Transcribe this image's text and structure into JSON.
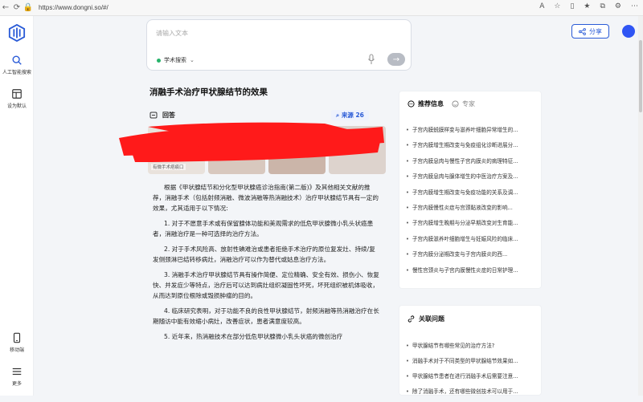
{
  "browser": {
    "url": "https://www.dongni.so/#/"
  },
  "sidebar": {
    "items": [
      {
        "label": "人工智能搜索",
        "icon": "search-icon"
      },
      {
        "label": "设为默认",
        "icon": "layout-icon"
      },
      {
        "label": "移动端",
        "icon": "mobile-icon"
      },
      {
        "label": "更多",
        "icon": "menu-icon"
      }
    ]
  },
  "header": {
    "share_label": "分享"
  },
  "search": {
    "placeholder": "请输入文本",
    "mode_label": "学术搜索"
  },
  "article": {
    "title": "消融手术治疗甲状腺结节的效果",
    "answer_label": "回答",
    "source_label": "来源 26",
    "image_caption": "有微手术疤痕口",
    "paragraphs": [
      "根据《甲状腺结节和分化型甲状腺癌诊治指南(第二版)》及其他相关文献的推荐，消融手术（包括射频消融、微波消融等热消融技术）治疗甲状腺结节具有一定的效果，尤其适用于以下情况:",
      "1. 对于不愿意手术或有保留腺体功能和美观需求的低危甲状腺微小乳头状癌患者，消融治疗是一种可选择的治疗方法。",
      "2. 对于手术风险高、放射性碘难治或患者拒绝手术治疗的原位复发灶、持续/复发侧颈淋巴结转移病灶，消融治疗可以作为替代或姑息治疗方法。",
      "3. 消融手术治疗甲状腺结节具有操作简便、定位精确、安全有效、损伤小、恢复快、并发症少等特点，治疗后可以达到病灶组织凝固性坏死，坏死组织被机体吸收，从而达到原位根除或毁损肿瘤的目的。",
      "4. 临床研究表明，对于功能不良的良性甲状腺结节，射频消融等热消融治疗在长期随访中能有效缩小病灶，改善症状，患者满意度较高。",
      "5. 近年来，热消融技术在部分低危甲状腺微小乳头状癌的微创治疗"
    ]
  },
  "recommend": {
    "tab_active": "推荐信息",
    "tab_inactive": "专家",
    "items": [
      "子宫内膜蜕膜样变与滋养叶细胞异常增生的...",
      "子宫内膜增生期改变与免疫组化诊断进展分...",
      "子宫内膜息肉与慢性子宫内膜炎的病理特征...",
      "子宫内膜息肉与腺体增生的中医治疗方案及...",
      "子宫内膜增生期改变与免疫功能的关系及调...",
      "子宫内膜慢性炎症与宫颈黏液改变的影响...",
      "子宫内膜增生晚期与分泌早期改变对生育能...",
      "子宫内膜滋养叶细胞增生与妊娠风险的临床...",
      "子宫内膜分泌期改变与子宫内膜炎的西...",
      "慢性宫颈炎与子宫内膜慢性炎症的日常护理..."
    ]
  },
  "related": {
    "title": "关联问题",
    "items": [
      "甲状腺结节有哪些常见的治疗方法?",
      "消融手术对于不同类型的甲状腺结节效果如...",
      "甲状腺结节患者在进行消融手术后需要注意...",
      "除了消融手术，还有哪些微创技术可以用于..."
    ]
  },
  "colors": {
    "accent": "#2a5bd7",
    "avatar": "#2f55f4",
    "redaction": "#ff1a1a"
  }
}
